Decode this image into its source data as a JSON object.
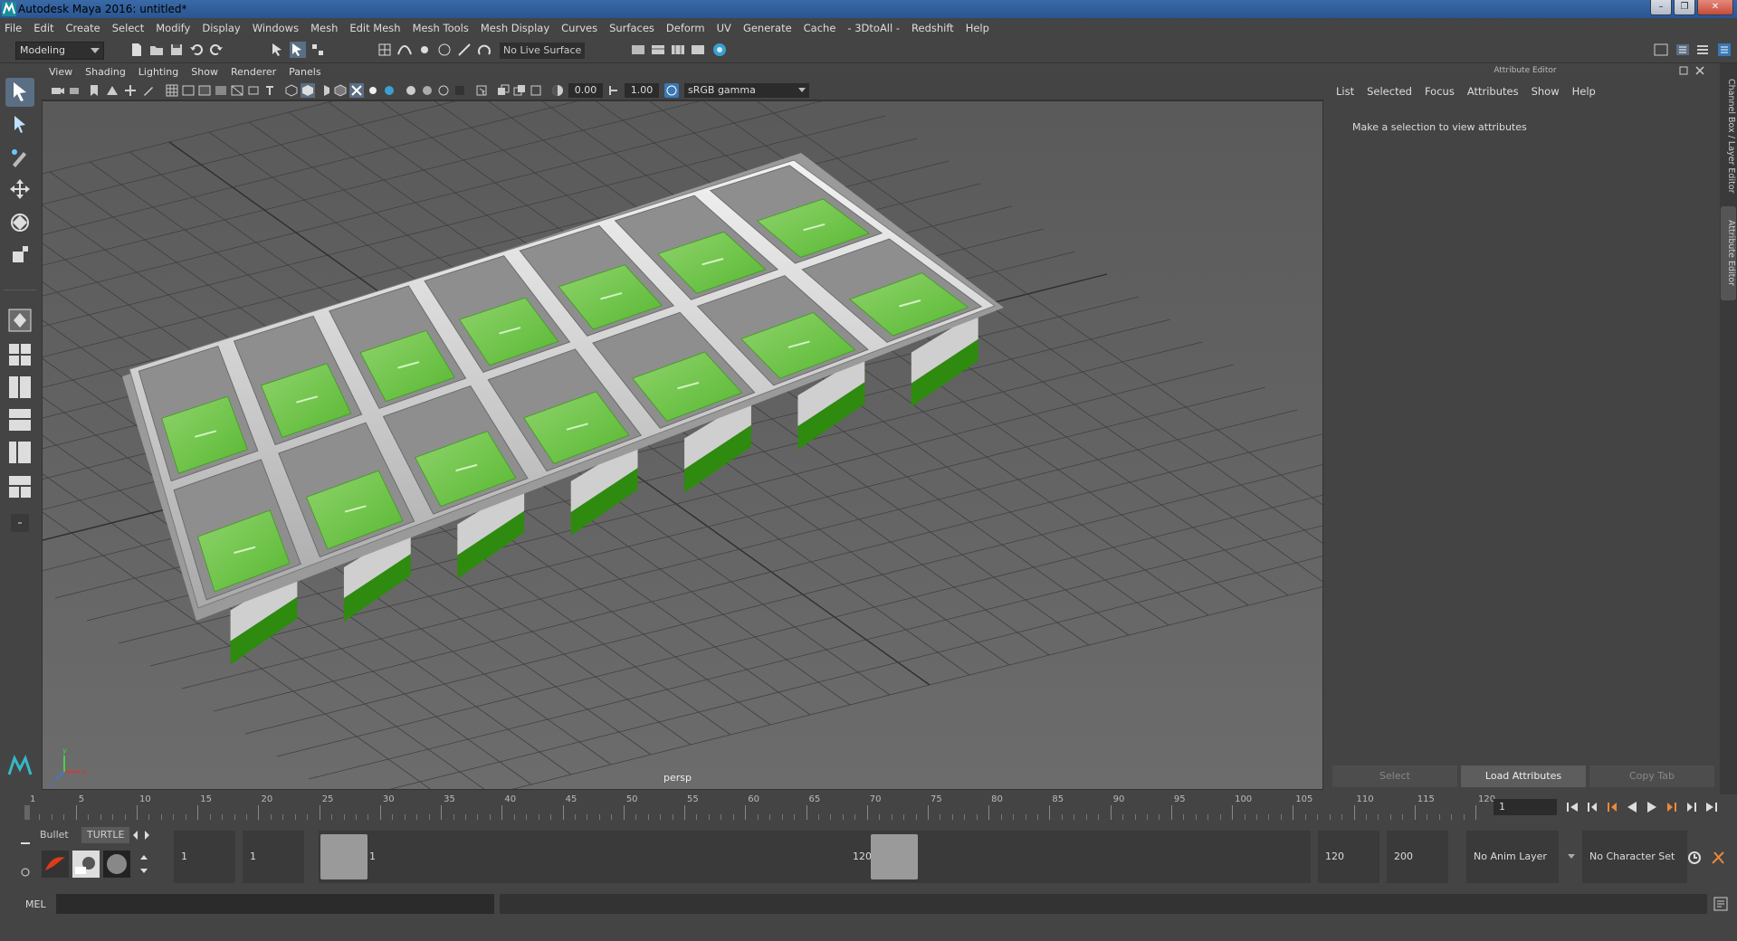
{
  "window": {
    "title": "Autodesk Maya 2016: untitled*",
    "buttons": [
      "–",
      "❐",
      "✕"
    ]
  },
  "menubar": {
    "items": [
      "File",
      "Edit",
      "Create",
      "Select",
      "Modify",
      "Display",
      "Windows",
      "Mesh",
      "Edit Mesh",
      "Mesh Tools",
      "Mesh Display",
      "Curves",
      "Surfaces",
      "Deform",
      "UV",
      "Generate",
      "Cache",
      "- 3DtoAll -",
      "Redshift",
      "Help"
    ]
  },
  "statusline": {
    "mode": "Modeling",
    "live_surface": "No Live Surface"
  },
  "viewport": {
    "menu": [
      "View",
      "Shading",
      "Lighting",
      "Show",
      "Renderer",
      "Panels"
    ],
    "exposure": "0.00",
    "gamma_value": "1.00",
    "color_space": "sRGB gamma",
    "camera": "persp",
    "axis_labels": {
      "x": "x",
      "y": "y",
      "z": "z"
    },
    "colors": {
      "tray": "#d8d8d8",
      "liquid": "#58b832",
      "liquid_dark": "#2f8a10",
      "bg_top": "#5a5a5a",
      "bg_bottom": "#6c6c6c"
    }
  },
  "attribute_editor": {
    "title": "Attribute Editor",
    "menu": [
      "List",
      "Selected",
      "Focus",
      "Attributes",
      "Show",
      "Help"
    ],
    "message": "Make a selection to view attributes",
    "buttons": {
      "select": "Select",
      "load": "Load Attributes",
      "copy": "Copy Tab"
    },
    "side_tabs": [
      "Channel Box / Layer Editor",
      "Attribute Editor"
    ]
  },
  "timeslider": {
    "ticks": [
      "1",
      "5",
      "10",
      "15",
      "20",
      "25",
      "30",
      "35",
      "40",
      "45",
      "50",
      "55",
      "60",
      "65",
      "70",
      "75",
      "80",
      "85",
      "90",
      "95",
      "100",
      "105",
      "110",
      "115",
      "120"
    ],
    "current_frame": "1"
  },
  "rangeslider": {
    "shelf_tabs": [
      "Bullet",
      "TURTLE"
    ],
    "start": "1",
    "playback_start": "1",
    "range_start_label": "1",
    "range_end_label": "120",
    "playback_end": "120",
    "end": "200",
    "anim_layer": "No Anim Layer",
    "character_set": "No Character Set"
  },
  "cmdline": {
    "label": "MEL"
  }
}
